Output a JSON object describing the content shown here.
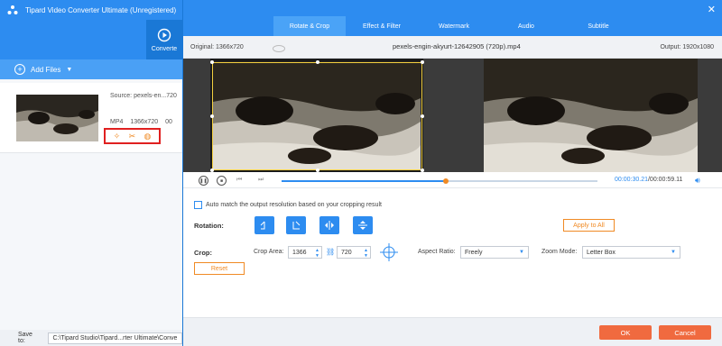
{
  "app": {
    "title": "Tipard Video Converter Ultimate (Unregistered)",
    "convert_tab_label": "Converte",
    "add_files_label": "Add Files",
    "file": {
      "source": "Source: pexels-en...720",
      "format": "MP4",
      "resolution": "1366x720",
      "duration": "00"
    },
    "save_to_label": "Save to:",
    "save_to_path": "C:\\Tipard Studio\\Tipard...rter Ultimate\\Conve"
  },
  "dialog": {
    "close_icon": "close-icon",
    "tabs": [
      {
        "label": "Rotate & Crop",
        "active": true
      },
      {
        "label": "Effect & Filter",
        "active": false
      },
      {
        "label": "Watermark",
        "active": false
      },
      {
        "label": "Audio",
        "active": false
      },
      {
        "label": "Subtitle",
        "active": false
      }
    ],
    "original_label": "Original: 1366x720",
    "filename": "pexels-engin-akyurt-12642905 (720p).mp4",
    "output_label": "Output: 1920x1080",
    "time_current": "00:00:30.21",
    "time_total": "/00:00:59.11",
    "progress": 0.52,
    "auto_match_label": "Auto match the output resolution based on your cropping result",
    "rotation_label": "Rotation:",
    "apply_all_label": "Apply to All",
    "crop_label": "Crop:",
    "crop_area_label": "Crop Area:",
    "crop_width": "1366",
    "crop_height": "720",
    "aspect_ratio_label": "Aspect Ratio:",
    "aspect_ratio_value": "Freely",
    "zoom_mode_label": "Zoom Mode:",
    "zoom_mode_value": "Letter Box",
    "reset_label": "Reset",
    "ok_label": "OK",
    "cancel_label": "Cancel"
  }
}
